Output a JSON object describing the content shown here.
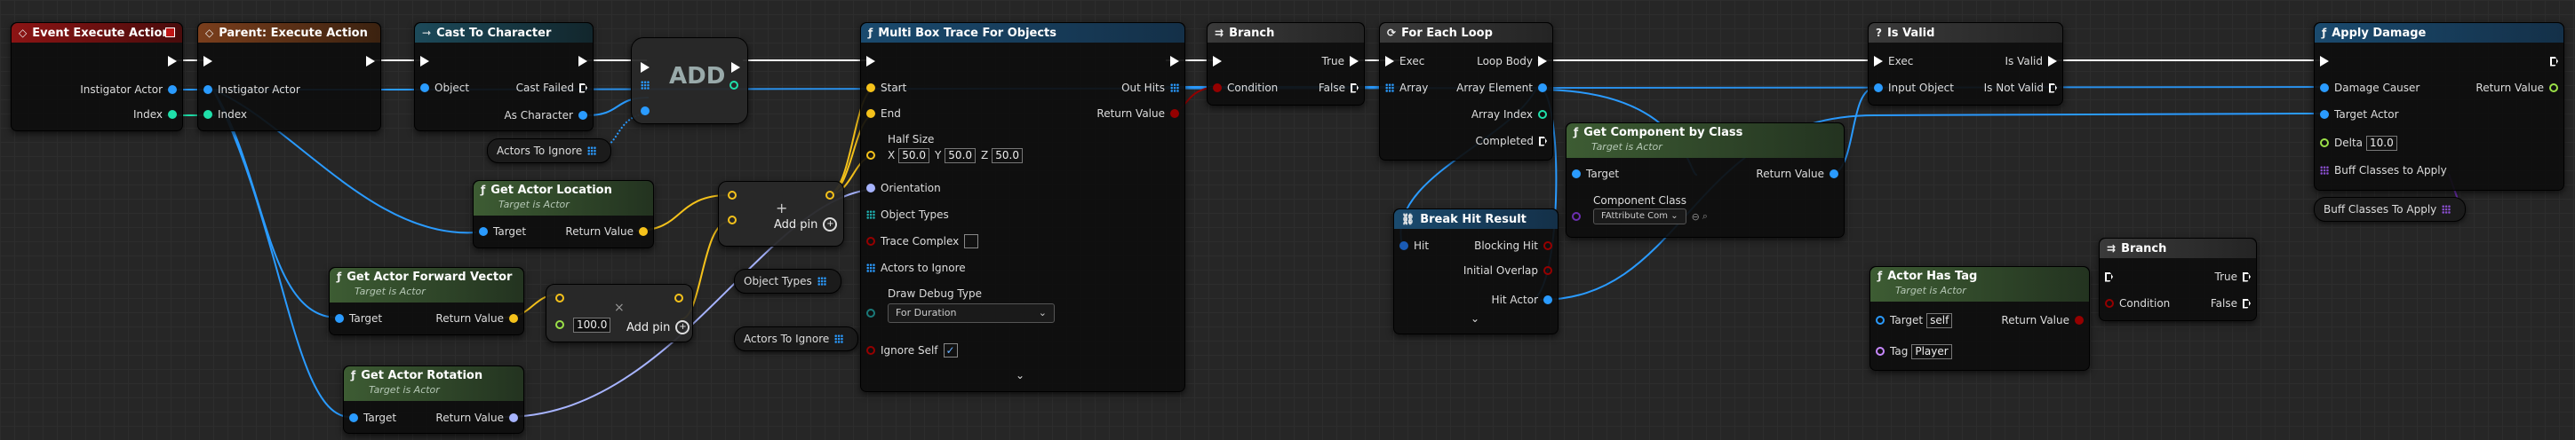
{
  "nodes": {
    "event": {
      "title": "Event Execute Action",
      "instigator": "Instigator Actor",
      "index": "Index"
    },
    "parent": {
      "title": "Parent: Execute Action",
      "instigator": "Instigator Actor",
      "index": "Index"
    },
    "cast": {
      "title": "Cast To Character",
      "object": "Object",
      "cast_failed": "Cast Failed",
      "as_character": "As Character"
    },
    "add_node": {
      "label": "ADD"
    },
    "actors_ignore_1": {
      "label": "Actors To Ignore"
    },
    "multibox": {
      "title": "Multi Box Trace For Objects",
      "start": "Start",
      "end": "End",
      "out_hits": "Out Hits",
      "return_value": "Return Value",
      "half_size": "Half Size",
      "x": "X",
      "x_val": "50.0",
      "y": "Y",
      "y_val": "50.0",
      "z": "Z",
      "z_val": "50.0",
      "orientation": "Orientation",
      "object_types": "Object Types",
      "trace_complex": "Trace Complex",
      "actors_to_ignore": "Actors to Ignore",
      "draw_debug": "Draw Debug Type",
      "draw_debug_val": "For Duration",
      "ignore_self": "Ignore Self"
    },
    "actor_location": {
      "title": "Get Actor Location",
      "target_is": "Target is Actor",
      "target": "Target",
      "return_value": "Return Value"
    },
    "forward_vector": {
      "title": "Get Actor Forward Vector",
      "target_is": "Target is Actor",
      "target": "Target",
      "return_value": "Return Value"
    },
    "actor_rotation": {
      "title": "Get Actor Rotation",
      "target_is": "Target is Actor",
      "target": "Target",
      "return_value": "Return Value"
    },
    "add_pin_1": {
      "label": "Add pin"
    },
    "multiply": {
      "value": "100.0",
      "add_pin": "Add pin"
    },
    "object_types_pill": {
      "label": "Object Types"
    },
    "actors_ignore_2": {
      "label": "Actors To Ignore"
    },
    "branch1": {
      "title": "Branch",
      "condition": "Condition",
      "true_label": "True",
      "false_label": "False"
    },
    "foreach": {
      "title": "For Each Loop",
      "exec": "Exec",
      "array": "Array",
      "loop_body": "Loop Body",
      "array_element": "Array Element",
      "array_index": "Array Index",
      "completed": "Completed"
    },
    "break_hit": {
      "title": "Break Hit Result",
      "hit": "Hit",
      "blocking_hit": "Blocking Hit",
      "initial_overlap": "Initial Overlap",
      "hit_actor": "Hit Actor"
    },
    "get_component": {
      "title": "Get Component by Class",
      "target_is": "Target is Actor",
      "target": "Target",
      "return_value": "Return Value",
      "component_class": "Component Class",
      "component_class_val": "FAttribute Com"
    },
    "is_valid": {
      "title": "Is Valid",
      "exec": "Exec",
      "input_object": "Input Object",
      "is_valid": "Is Valid",
      "is_not_valid": "Is Not Valid"
    },
    "actor_has_tag": {
      "title": "Actor Has Tag",
      "target_is": "Target is Actor",
      "target": "Target",
      "target_val": "self",
      "return_value": "Return Value",
      "tag": "Tag",
      "tag_val": "Player"
    },
    "branch2": {
      "title": "Branch",
      "condition": "Condition",
      "true_label": "True",
      "false_label": "False"
    },
    "apply_damage": {
      "title": "Apply Damage",
      "damage_causer": "Damage Causer",
      "return_value": "Return Value",
      "target_actor": "Target Actor",
      "delta": "Delta",
      "delta_val": "10.0",
      "buff_classes": "Buff Classes to Apply"
    },
    "buff_pill": {
      "label": "Buff Classes To Apply"
    }
  },
  "icons": {
    "event": "event-diamond-icon",
    "function": "function-f-icon",
    "cast": "cast-arrow-icon",
    "loop": "loop-icon",
    "question": "question-icon"
  },
  "colors": {
    "exec": "#ffffff",
    "object": "#2a9bff",
    "int": "#1fe0aa",
    "vector": "#f5c21b",
    "rotator": "#a7b4ff",
    "bool": "#950000",
    "class": "#6b2fb0",
    "name": "#c889ff",
    "float": "#9be048",
    "struct": "#1a5bb5",
    "event_header": "#8c1414",
    "parent_header": "#7a3e1c",
    "cast_header": "#1c4a5a",
    "pure_header": "#3d5c33",
    "grey_header": "#3a3a3a"
  }
}
